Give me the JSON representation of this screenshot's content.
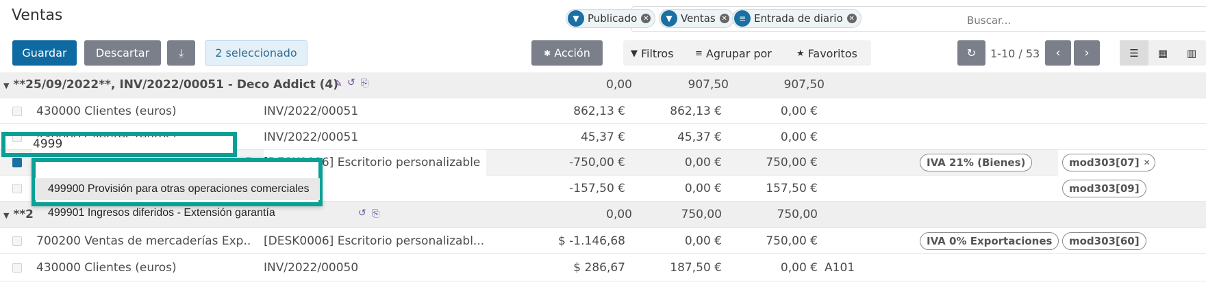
{
  "page": {
    "title": "Ventas"
  },
  "search": {
    "facets": [
      {
        "icon": "filter-icon",
        "label": "Publicado"
      },
      {
        "icon": "filter-icon",
        "label": "Ventas"
      },
      {
        "icon": "group-by-icon",
        "label": "Entrada de diario"
      }
    ],
    "placeholder": "Buscar..."
  },
  "toolbar": {
    "save_label": "Guardar",
    "discard_label": "Descartar",
    "download_icon": "download-icon",
    "selected_label": "2 seleccionado",
    "action_label": "Acción",
    "action_icon": "gear-icon"
  },
  "filters": {
    "filters_label": "Filtros",
    "groupby_label": "Agrupar por",
    "favorites_label": "Favoritos"
  },
  "pager": {
    "value": "1-10 / 53"
  },
  "views": [
    "list-view-icon",
    "pivot-view-icon",
    "graph-view-icon"
  ],
  "groups": [
    {
      "label": "**25/09/2022**, INV/2022/00051 - Deco Addict (4)",
      "balance": "0,00",
      "debit": "907,50",
      "credit": "907,50"
    },
    {
      "label": "**2",
      "balance": "0,00",
      "debit": "750,00",
      "credit": "750,00"
    }
  ],
  "rows": [
    {
      "account": "430000 Clientes (euros)",
      "label": "INV/2022/00051",
      "amount": "862,13 €",
      "debit": "862,13 €",
      "credit": "0,00 €",
      "tax": "",
      "tag": ""
    },
    {
      "account": "430000 Clientes (euros)",
      "label": "INV/2022/00051",
      "amount": "45,37 €",
      "debit": "45,37 €",
      "credit": "0,00 €",
      "tax": "",
      "tag": ""
    },
    {
      "account": "4999",
      "label": "[DESK0006] Escritorio personalizable",
      "amount": "-750,00 €",
      "debit": "0,00 €",
      "credit": "750,00 €",
      "tax": "IVA 21% (Bienes)",
      "tag": "mod303[07]"
    },
    {
      "account": "",
      "label": "",
      "amount": "-157,50 €",
      "debit": "0,00 €",
      "credit": "157,50 €",
      "tax": "",
      "tag": "mod303[09]"
    },
    {
      "account": "700200 Ventas de mercaderías Exp...",
      "label": "[DESK0006] Escritorio personalizabl...",
      "amount": "$ -1.146,68",
      "debit": "0,00 €",
      "credit": "750,00 €",
      "tax": "IVA 0% Exportaciones",
      "tag": "mod303[60]"
    },
    {
      "account": "430000 Clientes (euros)",
      "label": "INV/2022/00050",
      "amount": "$ 286,67",
      "debit": "187,50 €",
      "credit": "0,00 €",
      "analytic": "A101",
      "tax": "",
      "tag": ""
    }
  ],
  "dropdown": {
    "items": [
      "499900 Provisión para otras operaciones comerciales",
      "499901 Ingresos diferidos - Extensión garantía"
    ]
  },
  "colors": {
    "primary": "#0f6aa1",
    "secondary": "#7a7f8a",
    "highlight": "#0aa096"
  }
}
